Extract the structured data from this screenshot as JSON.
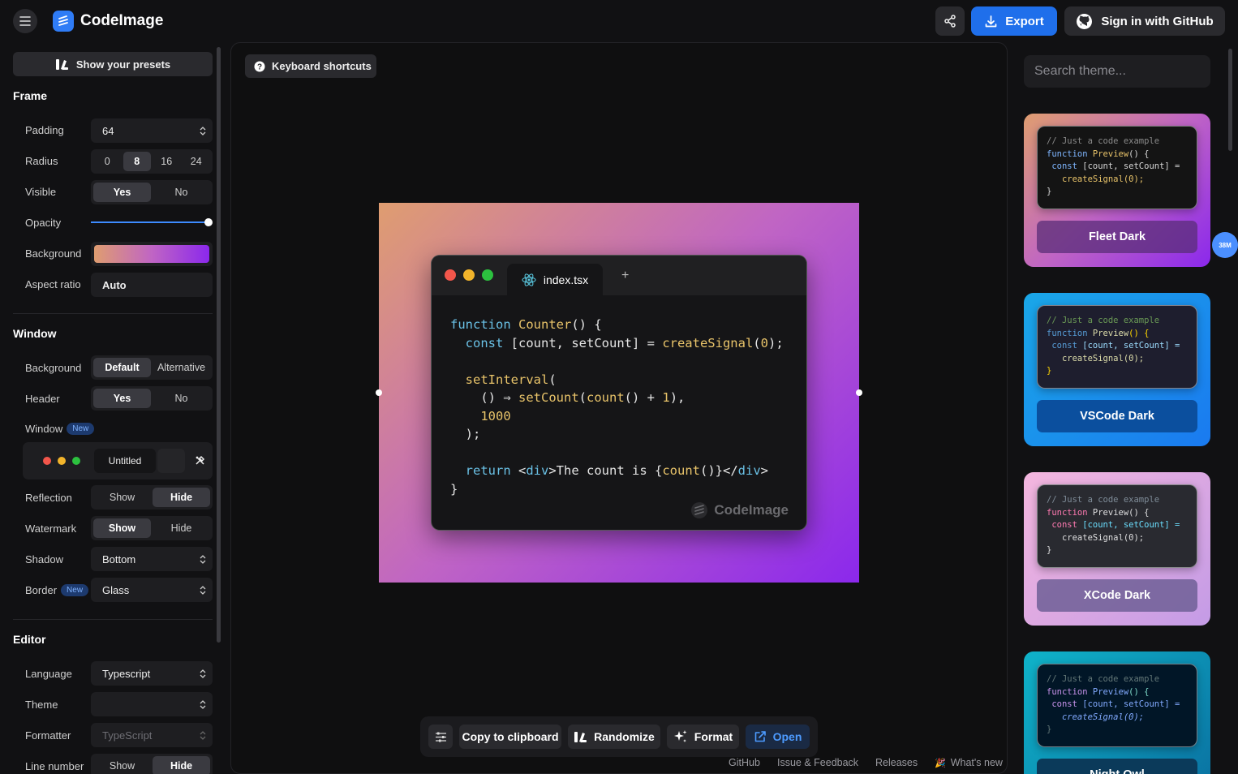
{
  "header": {
    "app_name": "CodeImage",
    "export_label": "Export",
    "github_label": "Sign in with GitHub"
  },
  "sidebar": {
    "presets_label": "Show your presets",
    "frame": {
      "title": "Frame",
      "padding_label": "Padding",
      "padding_value": "64",
      "radius_label": "Radius",
      "radius_options": [
        "0",
        "8",
        "16",
        "24"
      ],
      "visible_label": "Visible",
      "visible_options": [
        "Yes",
        "No"
      ],
      "opacity_label": "Opacity",
      "opacity_value": 1.0,
      "background_label": "Background",
      "aspect_label": "Aspect ratio",
      "aspect_value": "Auto"
    },
    "window": {
      "title": "Window",
      "background_label": "Background",
      "background_options": [
        "Default",
        "Alternative"
      ],
      "header_label": "Header",
      "header_options": [
        "Yes",
        "No"
      ],
      "window_label": "Window",
      "new_badge": "New",
      "window_tab_label": "Untitled",
      "reflection_label": "Reflection",
      "reflection_options": [
        "Show",
        "Hide"
      ],
      "watermark_label": "Watermark",
      "watermark_options": [
        "Show",
        "Hide"
      ],
      "shadow_label": "Shadow",
      "shadow_value": "Bottom",
      "border_label": "Border",
      "border_value": "Glass"
    },
    "editor": {
      "title": "Editor",
      "language_label": "Language",
      "language_value": "Typescript",
      "theme_label": "Theme",
      "theme_value": "",
      "formatter_label": "Formatter",
      "formatter_value": "TypeScript",
      "line_number_label": "Line number",
      "line_number_options": [
        "Show",
        "Hide"
      ]
    }
  },
  "canvas": {
    "shortcuts_label": "Keyboard shortcuts",
    "tab_name": "index.tsx",
    "add_tab": "+",
    "watermark": "CodeImage"
  },
  "toolbar": {
    "copy_label": "Copy to clipboard",
    "randomize_label": "Randomize",
    "format_label": "Format",
    "open_label": "Open"
  },
  "footer": {
    "github": "GitHub",
    "issue": "Issue & Feedback",
    "releases": "Releases",
    "whats_new": "What's new"
  },
  "themes_panel": {
    "search_placeholder": "Search theme...",
    "badge": "38M",
    "themes": [
      {
        "name": "Fleet Dark"
      },
      {
        "name": "VSCode Dark"
      },
      {
        "name": "XCode Dark"
      },
      {
        "name": "Night Owl"
      }
    ],
    "preview": {
      "comment": "// Just a code example",
      "line1a": "function",
      "line1b": "Preview",
      "line1c": "() {",
      "line2a": "const",
      "line2b": "[count, setCount] =",
      "line3": "createSignal(0);",
      "line4": "}"
    }
  },
  "colors": {
    "accent": "#1f6feb",
    "frame_gradient": [
      "#df9d70",
      "#c065c4",
      "#8b28ec"
    ]
  }
}
